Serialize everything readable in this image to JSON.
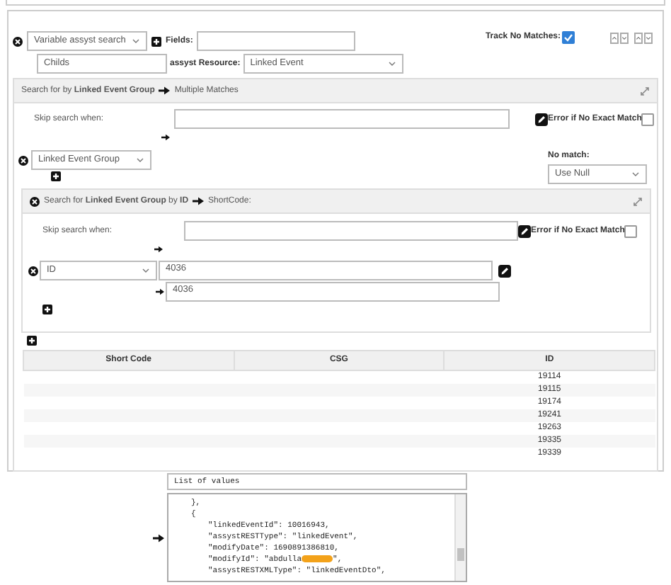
{
  "query": {
    "search_type": "Variable assyst search",
    "fields_label": "Fields:",
    "name": "Childs",
    "resource_label": "assyst Resource:",
    "resource": "Linked Event",
    "track_label": "Track No Matches:",
    "track_checked": true
  },
  "group_search": {
    "header": "Search for by **Linked Event Group**",
    "header_tail": "Multiple Matches",
    "skip_label": "Skip search when:",
    "error_label": "Error if No Exact Match",
    "error_checked": false,
    "field": "Linked Event Group",
    "no_match_label": "No match:",
    "no_match": "Use Null"
  },
  "id_search": {
    "header": "Search for **Linked Event Group** by **ID**",
    "header_tail": "ShortCode:",
    "skip_label": "Skip search when:",
    "error_label": "Error if No Exact Match",
    "error_checked": false,
    "field": "ID",
    "value": "4036",
    "mapped_value": "4036"
  },
  "table": {
    "columns": [
      "Short Code",
      "CSG",
      "ID"
    ],
    "rows": [
      {
        "id": "19114"
      },
      {
        "id": "19115"
      },
      {
        "id": "19174"
      },
      {
        "id": "19241"
      },
      {
        "id": "19263"
      },
      {
        "id": "19335"
      },
      {
        "id": "19339"
      }
    ]
  },
  "values_box": {
    "title": "List of values",
    "lines": [
      {
        "kind": "brace",
        "text": "},"
      },
      {
        "kind": "brace",
        "text": "{"
      },
      {
        "kind": "entry",
        "text": "\"linkedEventId\": 10016943,"
      },
      {
        "kind": "entry",
        "text": "\"assystRESTType\": \"linkedEvent\","
      },
      {
        "kind": "entry",
        "text": "\"modifyDate\": 1690891386810,"
      },
      {
        "kind": "entry",
        "text": "\"modifyId\": \"abdulla",
        "redacted": true,
        "tail": "\","
      },
      {
        "kind": "entry",
        "text": "\"assystRESTXMLType\": \"linkedEventDto\","
      }
    ]
  }
}
